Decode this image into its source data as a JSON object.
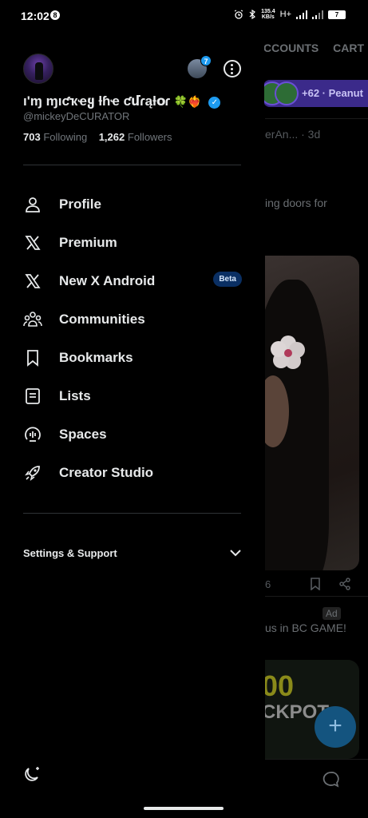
{
  "status_bar": {
    "time": "12:02",
    "notification_count": "8",
    "net_speed_top": "135.4",
    "net_speed_bottom": "KB/s",
    "network": "H+",
    "battery": "7"
  },
  "background": {
    "tabs": [
      "CCOUNTS",
      "CART"
    ],
    "community_pill": "+62 · Peanut",
    "post_meta": "erAn... · 3d",
    "post_text": "ing doors for",
    "post_count": "6",
    "ad_badge": "Ad",
    "ad_text": "us in BC GAME!",
    "ad_image_top": "00",
    "ad_image_bottom": "CKPOT",
    "fab_symbol": "+"
  },
  "drawer": {
    "account_switch_badge": "7",
    "display_name": "ı'ɱ ɱıƈҡҽყ ƚɦҽ ƈմɾąƚօɾ",
    "display_name_emoji": "🍀❤️‍🔥",
    "handle": "@mickeyDeCURATOR",
    "following_count": "703",
    "following_label": "Following",
    "followers_count": "1,262",
    "followers_label": "Followers",
    "menu": [
      {
        "label": "Profile",
        "icon": "person-icon"
      },
      {
        "label": "Premium",
        "icon": "x-logo-icon"
      },
      {
        "label": "New X Android",
        "icon": "x-logo-icon",
        "badge": "Beta"
      },
      {
        "label": "Communities",
        "icon": "communities-icon"
      },
      {
        "label": "Bookmarks",
        "icon": "bookmark-icon"
      },
      {
        "label": "Lists",
        "icon": "list-icon"
      },
      {
        "label": "Spaces",
        "icon": "spaces-icon"
      },
      {
        "label": "Creator Studio",
        "icon": "rocket-icon"
      }
    ],
    "settings_label": "Settings & Support"
  },
  "colors": {
    "background": "#000000",
    "text": "#e7e9ea",
    "secondary_text": "#71767b",
    "accent": "#1d9bf0",
    "beta_bg": "#0a2f63"
  }
}
